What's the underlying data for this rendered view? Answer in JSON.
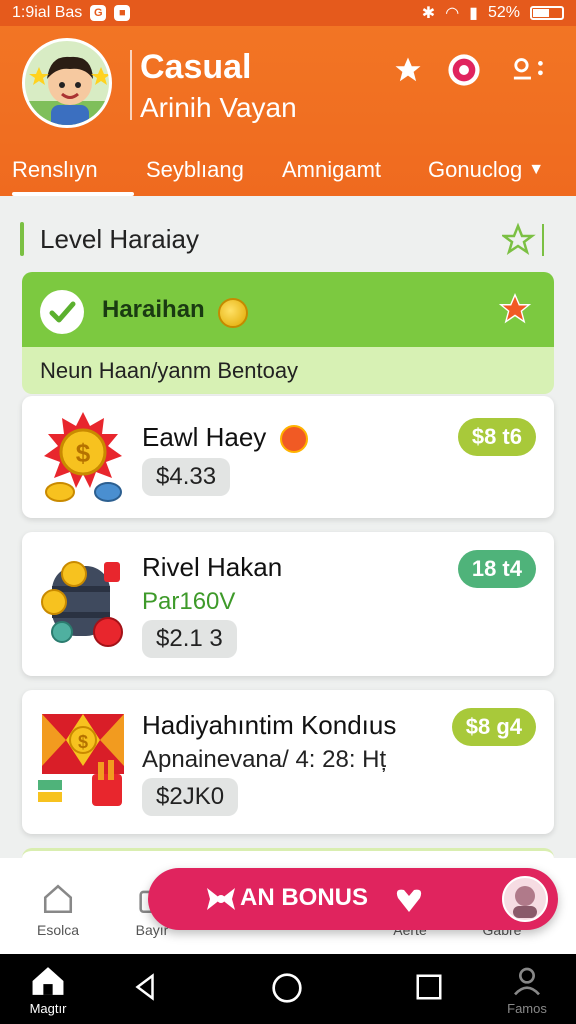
{
  "status_bar": {
    "time": "1:9ial Bas",
    "battery": "52%"
  },
  "header": {
    "title": "Casual",
    "subtitle": "Arinih Vayan",
    "tabs": [
      "Renslıyn",
      "Seyblıang",
      "Amnigamt",
      "Gonuclog"
    ]
  },
  "section": {
    "title": "Level Haraiay"
  },
  "level_card": {
    "name": "Haraihan",
    "subtitle": "Neun Haan/yanm Bentoay"
  },
  "rewards": [
    {
      "title": "Eawl Haey",
      "subtitle": "",
      "price": "$4.33",
      "badge": "$8 t6",
      "badge_color": "#a8c93a"
    },
    {
      "title": "Rivel Hakan",
      "subtitle": "Par160V",
      "price": "$2.1 3",
      "badge": "18 t4",
      "badge_color": "#4fb37a"
    },
    {
      "title": "Hadiyahıntim Kondıus",
      "subtitle": "Apnainevana/ 4: 28: Hț",
      "price": "$2JK0",
      "badge": "$8 g4",
      "badge_color": "#a8c93a"
    }
  ],
  "bottom_nav": {
    "items": [
      "Esolca",
      "Bayır",
      "Aerte",
      "Gabre"
    ]
  },
  "bonus_button": {
    "label": "AN BONUS"
  },
  "system_nav": {
    "home_label": "Magtır",
    "profile_label": "Famos"
  },
  "colors": {
    "accent": "#ef6a1f",
    "green": "#7cc940",
    "bonus": "#e0245e"
  }
}
